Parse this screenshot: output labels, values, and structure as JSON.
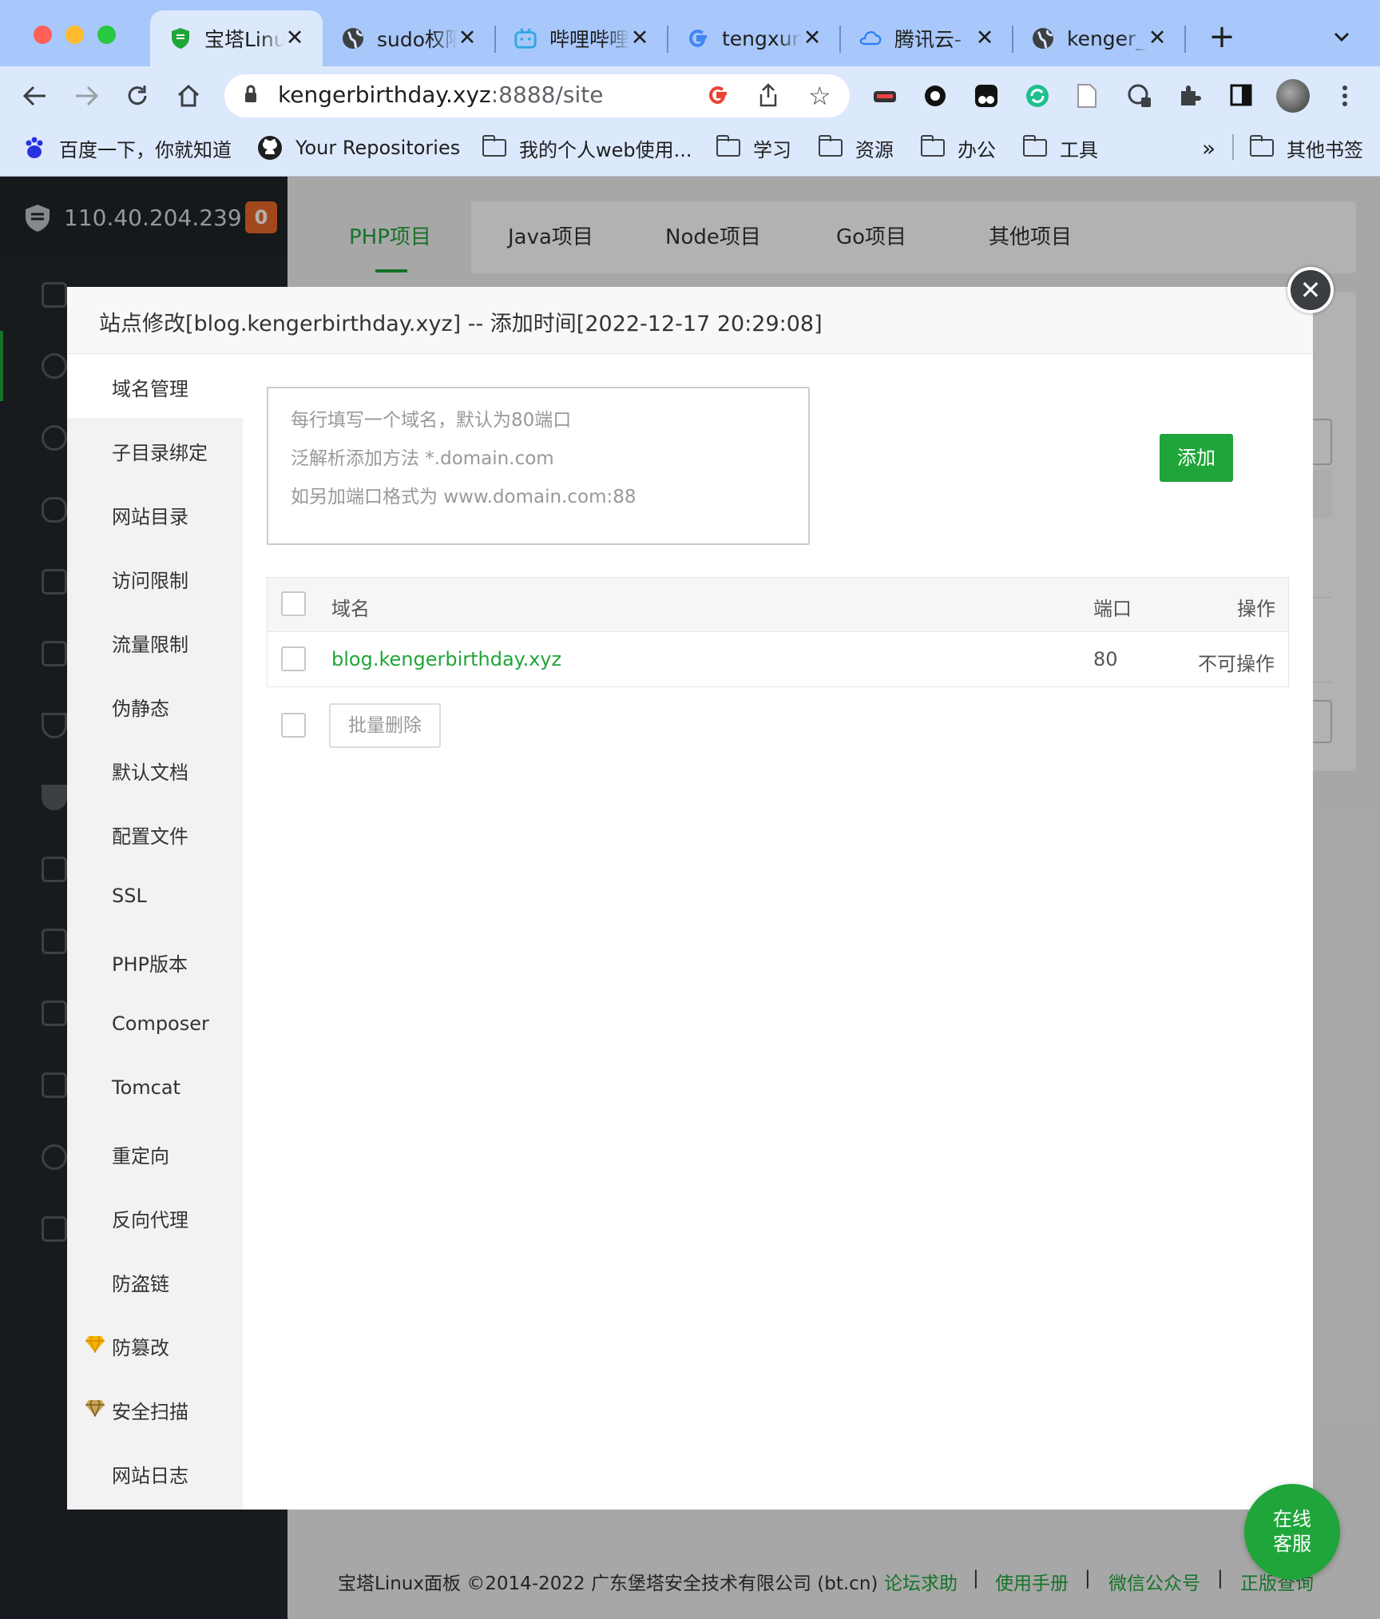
{
  "browser": {
    "tabs": [
      {
        "title": "宝塔Linux面板",
        "icon": "baota-shield-icon",
        "active": true
      },
      {
        "title": "sudo权限",
        "icon": "globe-icon"
      },
      {
        "title": "哔哩哔哩",
        "icon": "bilibili-icon"
      },
      {
        "title": "tengxun",
        "icon": "google-icon"
      },
      {
        "title": "腾讯云-",
        "icon": "tencent-cloud-icon"
      },
      {
        "title": "kenger_",
        "icon": "globe-icon"
      }
    ],
    "url_host": "kengerbirthday.xyz",
    "url_path": ":8888/site",
    "bookmarks": [
      {
        "label": "百度一下，你就知道",
        "icon": "baidu-paw-icon"
      },
      {
        "label": "Your Repositories",
        "icon": "github-icon"
      },
      {
        "label": "我的个人web使用...",
        "icon": "folder-icon"
      },
      {
        "label": "学习",
        "icon": "folder-icon"
      },
      {
        "label": "资源",
        "icon": "folder-icon"
      },
      {
        "label": "办公",
        "icon": "folder-icon"
      },
      {
        "label": "工具",
        "icon": "folder-icon"
      }
    ],
    "bookmarks_more": "»",
    "other_bookmarks": "其他书签"
  },
  "panel": {
    "server_ip": "110.40.204.239",
    "notification_count": "0",
    "project_tabs": [
      "PHP项目",
      "Java项目",
      "Node项目",
      "Go项目",
      "其他项目"
    ],
    "active_project_tab": 0
  },
  "modal": {
    "title": "站点修改[blog.kengerbirthday.xyz] -- 添加时间[2022-12-17 20:29:08]",
    "close_icon": "close-icon",
    "nav": [
      {
        "label": "域名管理",
        "active": true
      },
      {
        "label": "子目录绑定"
      },
      {
        "label": "网站目录"
      },
      {
        "label": "访问限制"
      },
      {
        "label": "流量限制"
      },
      {
        "label": "伪静态"
      },
      {
        "label": "默认文档"
      },
      {
        "label": "配置文件"
      },
      {
        "label": "SSL"
      },
      {
        "label": "PHP版本"
      },
      {
        "label": "Composer"
      },
      {
        "label": "Tomcat"
      },
      {
        "label": "重定向"
      },
      {
        "label": "反向代理"
      },
      {
        "label": "防盗链"
      },
      {
        "label": "防篡改",
        "icon": "gem-icon"
      },
      {
        "label": "安全扫描",
        "icon": "gem-icon"
      },
      {
        "label": "网站日志"
      }
    ],
    "domain_input_placeholder": "每行填写一个域名，默认为80端口\n泛解析添加方法 *.domain.com\n如另加端口格式为 www.domain.com:88",
    "add_button": "添加",
    "table": {
      "headers": {
        "domain": "域名",
        "port": "端口",
        "action": "操作"
      },
      "rows": [
        {
          "domain": "blog.kengerbirthday.xyz",
          "port": "80",
          "action": "不可操作"
        }
      ]
    },
    "batch_delete": "批量删除"
  },
  "footer": {
    "copyright": "宝塔Linux面板 ©2014-2022 广东堡塔安全技术有限公司 (bt.cn)",
    "links": [
      "论坛求助",
      "使用手册",
      "微信公众号",
      "正版查询"
    ],
    "separator": "|"
  },
  "online_service": {
    "line1": "在线",
    "line2": "客服"
  },
  "colors": {
    "brand_green": "#20a53a",
    "sidebar_dark": "#21272d",
    "tab_strip": "#a8c7fa"
  }
}
